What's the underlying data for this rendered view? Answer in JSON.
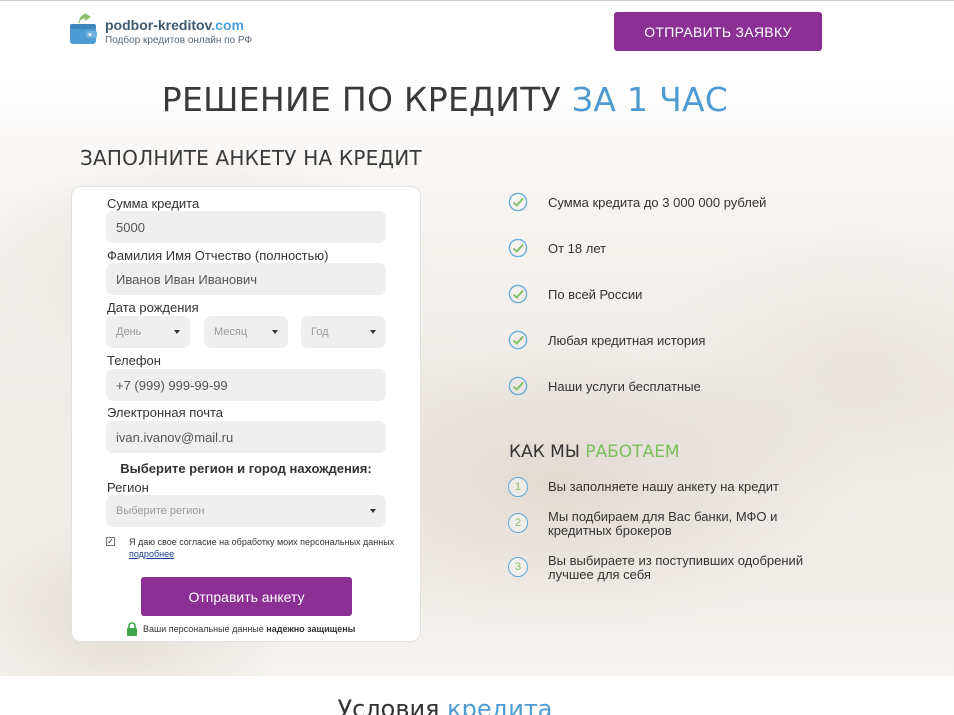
{
  "header": {
    "logo_name": "podbor-kreditov",
    "logo_domain": ".com",
    "logo_subtitle": "Подбор кредитов онлайн по РФ",
    "cta_label": "ОТПРАВИТЬ ЗАЯВКУ"
  },
  "hero": {
    "title_main": "РЕШЕНИЕ ПО КРЕДИТУ",
    "title_accent": "ЗА 1 ЧАС",
    "accent_color": "#4d9bd2"
  },
  "form": {
    "title": "ЗАПОЛНИТЕ АНКЕТУ НА КРЕДИТ",
    "amount_label": "Сумма кредита",
    "amount_value": "5000",
    "fio_label": "Фамилия Имя Отчество (полностью)",
    "fio_placeholder": "Иванов Иван Иванович",
    "birth_label": "Дата рождения",
    "day_placeholder": "День",
    "month_placeholder": "Месяц",
    "year_placeholder": "Год",
    "phone_label": "Телефон",
    "phone_placeholder": "+7 (999) 999-99-99",
    "email_label": "Электронная почта",
    "email_placeholder": "ivan.ivanov@mail.ru",
    "region_heading": "Выберите регион и город нахождения:",
    "region_label": "Регион",
    "region_placeholder": "Выберите регион",
    "consent_text": "Я даю свое согласие на обработку моих персональных данных",
    "consent_link": "подробнее",
    "consent_checked": true,
    "submit_label": "Отправить анкету",
    "secure_text": "Ваши персональные данные",
    "secure_bold": "надежно защищены",
    "button_color": "#8b2f95"
  },
  "features": {
    "items": [
      "Сумма кредита до 3 000 000 рублей",
      "От 18 лет",
      "По всей России",
      "Любая кредитная история",
      "Наши услуги бесплатные"
    ]
  },
  "how": {
    "title_main": "КАК МЫ",
    "title_accent": "РАБОТАЕМ",
    "accent_color": "#7dbd5e",
    "steps": [
      {
        "num": "1",
        "text": "Вы заполняете нашу анкету на кредит"
      },
      {
        "num": "2",
        "text": "Мы подбираем для Вас банки, МФО и кредитных брокеров"
      },
      {
        "num": "3",
        "text": "Вы выбираете из поступивших одобрений лучшее для себя"
      }
    ]
  },
  "bottom": {
    "title_main": "Условия",
    "title_accent": "кредита"
  }
}
